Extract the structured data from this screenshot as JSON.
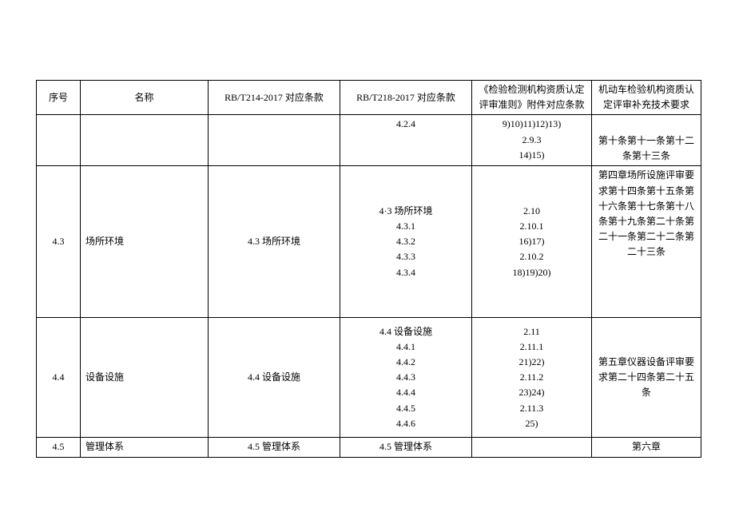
{
  "headers": {
    "col1": "序号",
    "col2": "名称",
    "col3": "RB/T214-2017 对应条款",
    "col4": "RB/T218-2017 对应条款",
    "col5": "《检验检测机构资质认定评审准则》附件对应条款",
    "col6": "机动车检验机构资质认定评审补充技术要求"
  },
  "rows": [
    {
      "xuhao": "",
      "name": "",
      "t214": "",
      "t218": "4.2.4",
      "zhunze": "9)10)11)12)13)\n2.9.3\n14)15)",
      "buchong": "第十条第十一条第十二条第十三条"
    },
    {
      "xuhao": "4.3",
      "name": "场所环境",
      "t214": "4.3 场所环境",
      "t218": "4·3 场所环境\n4.3.1\n4.3.2\n4.3.3\n4.3.4",
      "zhunze": "2.10\n2.10.1\n16)17)\n2.10.2\n18)19)20)",
      "buchong": "第四章场所设施评审要求第十四条第十五条第十六条第十七条第十八条第十九条第二十条第二十一条第二十二条第二十三条"
    },
    {
      "xuhao": "4.4",
      "name": "设备设施",
      "t214": "4.4 设备设施",
      "t218": "4.4 设备设施\n4.4.1\n4.4.2\n4.4.3\n4.4.4\n4.4.5\n4.4.6",
      "zhunze": "2.11\n2.11.1\n21)22)\n2.11.2\n23)24)\n2.11.3\n25)",
      "buchong": "第五章仪器设备评审要求第二十四条第二十五条"
    },
    {
      "xuhao": "4.5",
      "name": "管理体系",
      "t214": "4.5 管理体系",
      "t218": "4.5 管理体系",
      "zhunze": "",
      "buchong": "第六章"
    }
  ]
}
